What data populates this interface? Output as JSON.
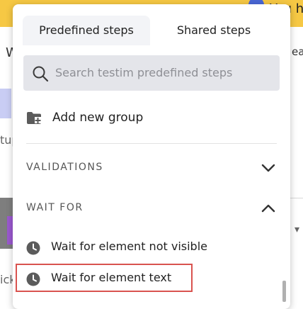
{
  "background": {
    "top_right_text": "You h",
    "left_text_w": "W",
    "left_text_tup": "tup",
    "left_text_ick": "ick",
    "right_text_ead": "ead"
  },
  "popup": {
    "tabs": [
      {
        "label": "Predefined steps",
        "active": true
      },
      {
        "label": "Shared steps",
        "active": false
      }
    ],
    "search": {
      "placeholder": "Search testim predefined steps",
      "icon": "search-icon"
    },
    "add_group": {
      "label": "Add new group",
      "icon": "folder-plus-icon"
    },
    "sections": [
      {
        "title": "VALIDATIONS",
        "expanded": false,
        "icon": "chevron-down-icon"
      },
      {
        "title": "WAIT FOR",
        "expanded": true,
        "icon": "chevron-up-icon"
      }
    ],
    "wait_for_steps": [
      {
        "label": "Wait for element not visible",
        "icon": "clock-icon",
        "highlighted": false
      },
      {
        "label": "Wait for element text",
        "icon": "clock-icon",
        "highlighted": true
      }
    ]
  },
  "colors": {
    "topbar": "#f6c844",
    "highlight_border": "#d9534f",
    "search_bg": "#e4e5ea",
    "icon_gray": "#5b5b5b"
  }
}
